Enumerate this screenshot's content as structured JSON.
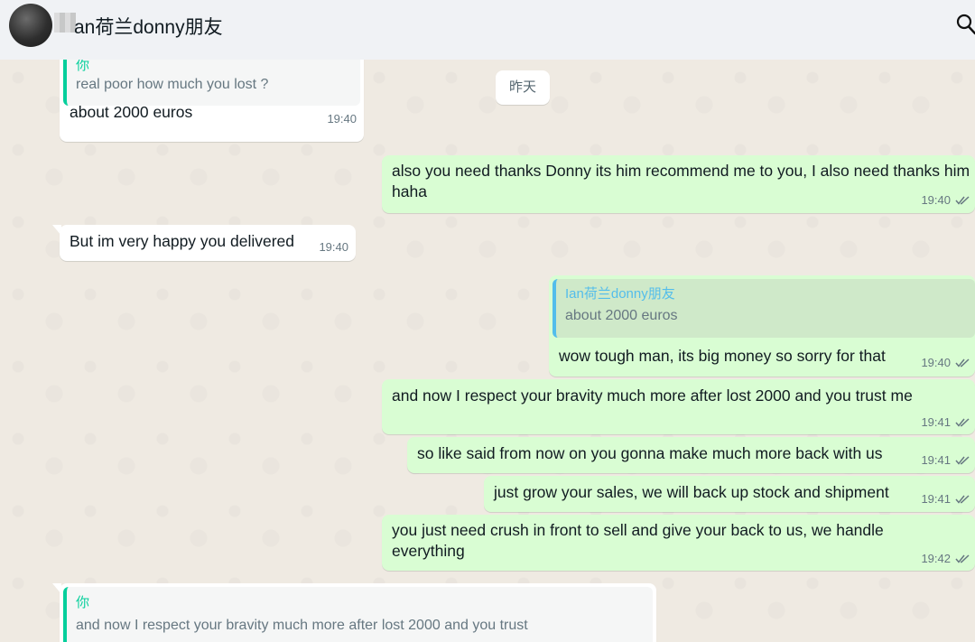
{
  "header": {
    "contact_name": "an荷兰donny朋友",
    "search_icon": "search-icon"
  },
  "chat": {
    "date_divider": "昨天",
    "messages": [
      {
        "direction": "in",
        "quote_author": "你",
        "quote_text": "real poor how much you lost ?",
        "text": "about 2000 euros",
        "time": "19:40"
      },
      {
        "direction": "out",
        "text": "also you need thanks Donny its him recommend me to you, I also need thanks him haha",
        "time": "19:40",
        "status": "read"
      },
      {
        "direction": "in",
        "text": "But im very happy you delivered",
        "time": "19:40"
      },
      {
        "direction": "out",
        "quote_author": "Ian荷兰donny朋友",
        "quote_text": "about 2000 euros",
        "text": "wow tough man, its big money so sorry for that",
        "time": "19:40",
        "status": "read"
      },
      {
        "direction": "out",
        "text": "and now I respect your bravity much more after lost 2000 and you trust me",
        "time": "19:41",
        "status": "read"
      },
      {
        "direction": "out",
        "text": "so like said from now on you gonna make much more back with us",
        "time": "19:41",
        "status": "read"
      },
      {
        "direction": "out",
        "text": "just grow your sales, we will back up stock and shipment",
        "time": "19:41",
        "status": "read"
      },
      {
        "direction": "out",
        "text": "you just need crush in front to sell and give your back to us, we handle everything",
        "time": "19:42",
        "status": "read"
      },
      {
        "direction": "in",
        "quote_author": "你",
        "quote_text": "and now I respect your bravity much more after lost 2000 and you trust"
      }
    ]
  },
  "colors": {
    "outgoing_bubble": "#d9fdd3",
    "incoming_bubble": "#ffffff",
    "chat_background": "#efeae2",
    "read_ticks": "#667781",
    "quote_bar_self": "#06cf9c",
    "quote_bar_contact": "#53bdeb"
  }
}
